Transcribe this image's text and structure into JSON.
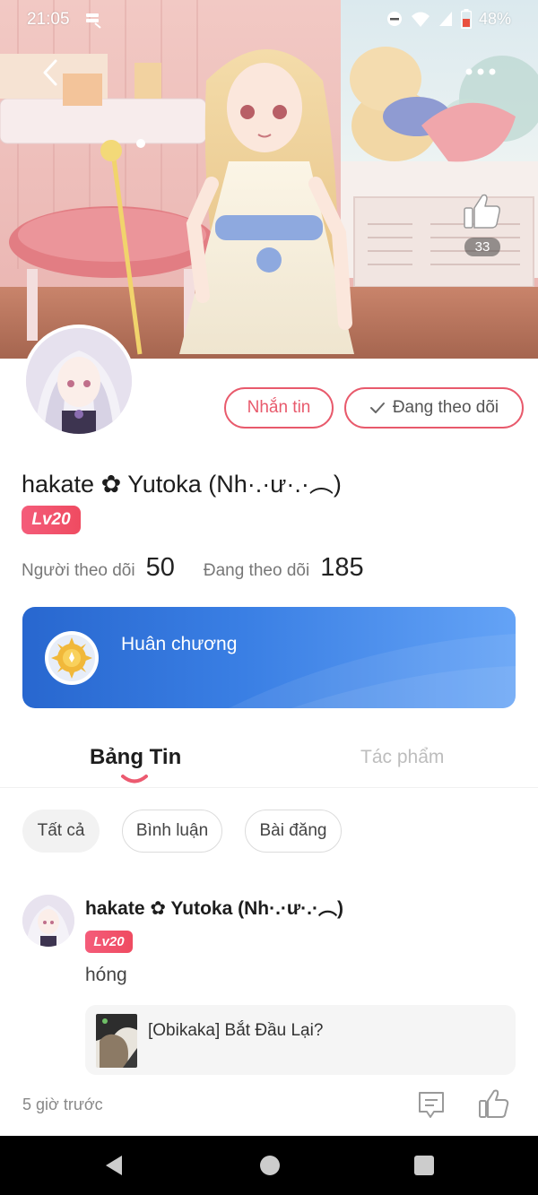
{
  "status_bar": {
    "time": "21:05",
    "battery_percent": "48%",
    "icons": [
      "storage-icon",
      "dnd-icon",
      "wifi-icon",
      "signal-icon",
      "battery-icon"
    ]
  },
  "header": {
    "back_icon": "chevron-left-icon",
    "more_icon": "more-dots-icon",
    "like_icon": "thumbs-up-icon",
    "like_count": "33"
  },
  "profile": {
    "message_button": "Nhắn tin",
    "following_button": "Đang theo dõi",
    "username": "hakate ✿ Yutoka (Nh·.·ư·.·︵)",
    "level": "Lv20",
    "followers_label": "Người theo dõi",
    "followers_count": "50",
    "following_label": "Đang theo dõi",
    "following_count": "185"
  },
  "medal": {
    "label": "Huân chương",
    "icon": "medal-icon"
  },
  "tabs": {
    "feed": "Bảng Tin",
    "works": "Tác phẩm",
    "active": "feed"
  },
  "filters": {
    "all": "Tất cả",
    "comments": "Bình luận",
    "posts": "Bài đăng",
    "selected": "all"
  },
  "post": {
    "author": "hakate ✿ Yutoka (Nh·.·ư·.·︵)",
    "level": "Lv20",
    "text": "hóng",
    "link_title": "[Obikaka] Bắt Đầu Lại?",
    "time": "5 giờ trước",
    "comment_icon": "comment-icon",
    "like_icon": "thumbs-up-outline-icon"
  },
  "colors": {
    "accent": "#e85a6c",
    "level_badge": "#f0506a",
    "medal_card_start": "#2867cf",
    "medal_card_end": "#64a3f6",
    "nav_bar": "#000000"
  }
}
